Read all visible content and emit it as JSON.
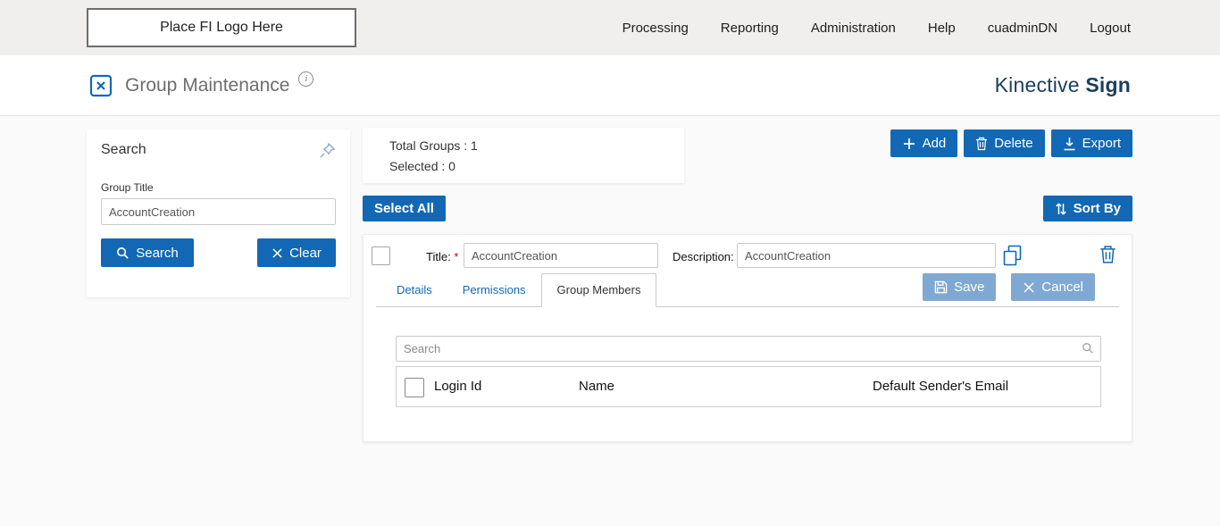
{
  "topbar": {
    "logo_placeholder": "Place FI Logo Here",
    "nav": [
      {
        "label": "Processing"
      },
      {
        "label": "Reporting"
      },
      {
        "label": "Administration"
      },
      {
        "label": "Help"
      },
      {
        "label": "cuadminDN"
      },
      {
        "label": "Logout"
      }
    ]
  },
  "header": {
    "title": "Group Maintenance",
    "info_glyph": "i",
    "brand_regular": "Kinective",
    "brand_bold": "Sign"
  },
  "search_panel": {
    "title": "Search",
    "group_title_label": "Group Title",
    "group_title_value": "AccountCreation",
    "search_button": "Search",
    "clear_button": "Clear"
  },
  "summary": {
    "total_groups": "Total Groups : 1",
    "selected": "Selected : 0"
  },
  "toolbar": {
    "add": "Add",
    "delete": "Delete",
    "export": "Export",
    "select_all": "Select All",
    "sort_by": "Sort By"
  },
  "group_row": {
    "title_label": "Title:",
    "description_label": "Description:",
    "required_marker": "*",
    "title_value": "AccountCreation",
    "description_value": "AccountCreation",
    "tabs": [
      {
        "label": "Details"
      },
      {
        "label": "Permissions"
      },
      {
        "label": "Group Members"
      }
    ],
    "active_tab": "Group Members",
    "save_button": "Save",
    "cancel_button": "Cancel",
    "members": {
      "search_placeholder": "Search",
      "columns": [
        {
          "label": "Login Id"
        },
        {
          "label": "Name"
        },
        {
          "label": "Default Sender's Email"
        }
      ]
    }
  },
  "colors": {
    "primary_blue": "#1268b4",
    "muted_blue": "#7fa9d2",
    "brand_navy": "#1c3e5c",
    "topbar_gray": "#f1efee",
    "required_red": "#d60000"
  }
}
